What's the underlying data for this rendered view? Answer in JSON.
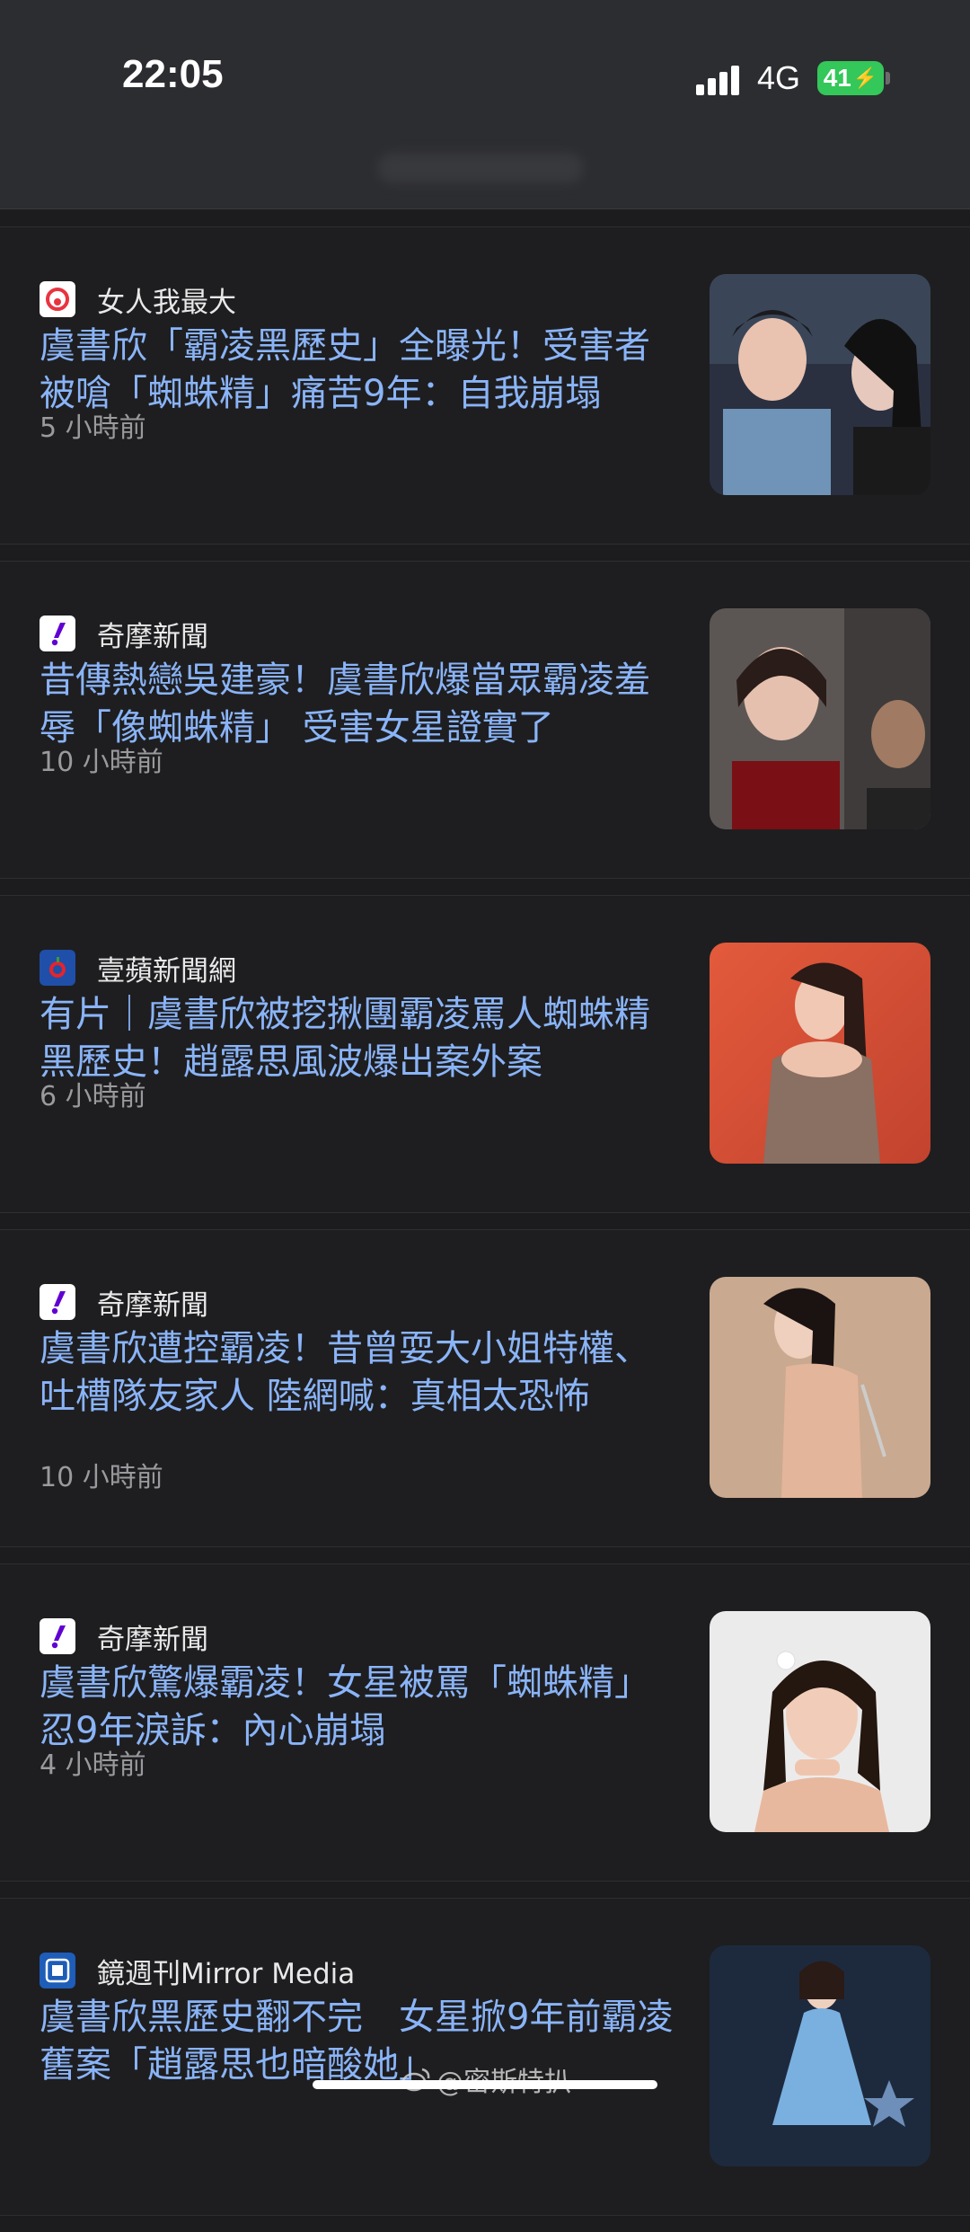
{
  "status_bar": {
    "time": "22:05",
    "network": "4G",
    "battery": "41"
  },
  "feed": [
    {
      "source": "女人我最大",
      "source_icon": "womany-logo-icon",
      "title": "虞書欣「霸凌黑歷史」全曝光！受害者被嗆「蜘蛛精」痛苦9年：自我崩塌",
      "time": "5 小時前",
      "thumb": "photo-two-women"
    },
    {
      "source": "奇摩新聞",
      "source_icon": "yahoo-exclaim-icon",
      "title": "昔傳熱戀吳建豪！虞書欣爆當眾霸凌羞辱「像蜘蛛精」 受害女星證實了",
      "time": "10 小時前",
      "thumb": "photo-woman-and-man"
    },
    {
      "source": "壹蘋新聞網",
      "source_icon": "nextapple-logo-icon",
      "title": "有片｜虞書欣被挖揪團霸凌罵人蜘蛛精黑歷史！趙露思風波爆出案外案",
      "time": "6 小時前",
      "thumb": "photo-woman-orange-bg"
    },
    {
      "source": "奇摩新聞",
      "source_icon": "yahoo-exclaim-icon",
      "title": "虞書欣遭控霸凌！昔曾耍大小姐特權、吐槽隊友家人 陸網喊：真相太恐怖",
      "time": "10 小時前",
      "thumb": "photo-woman-beige-bg"
    },
    {
      "source": "奇摩新聞",
      "source_icon": "yahoo-exclaim-icon",
      "title": "虞書欣驚爆霸凌！女星被罵「蜘蛛精」 忍9年淚訴：內心崩塌",
      "time": "4 小時前",
      "thumb": "photo-woman-white-bg"
    },
    {
      "source": "鏡週刊Mirror Media",
      "source_icon": "mirror-media-icon",
      "title": "虞書欣黑歷史翻不完　女星掀9年前霸凌舊案「趙露思也暗酸她」",
      "time": "",
      "thumb": "photo-woman-blue-dress"
    }
  ],
  "watermark": "@密斯特扒",
  "colors": {
    "background": "#1c1c1e",
    "title_link": "#8ab4f8",
    "source_text": "#e8e8e8",
    "meta_text": "#9a9a9e",
    "battery": "#34c759"
  }
}
